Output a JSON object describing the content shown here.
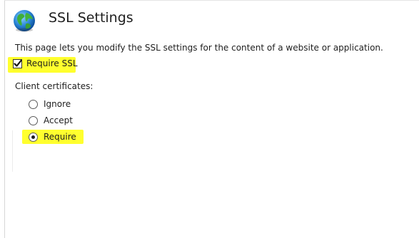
{
  "page": {
    "title": "SSL Settings",
    "icon": "globe-icon",
    "description": "This page lets you modify the SSL settings for the content of a website or application."
  },
  "require_ssl": {
    "label": "Require SSL",
    "checked": true
  },
  "client_certificates": {
    "label": "Client certificates:",
    "options": [
      {
        "label": "Ignore",
        "selected": false
      },
      {
        "label": "Accept",
        "selected": false
      },
      {
        "label": "Require",
        "selected": true
      }
    ]
  },
  "colors": {
    "highlight": "#ffff2e",
    "text": "#1e1e1e"
  }
}
